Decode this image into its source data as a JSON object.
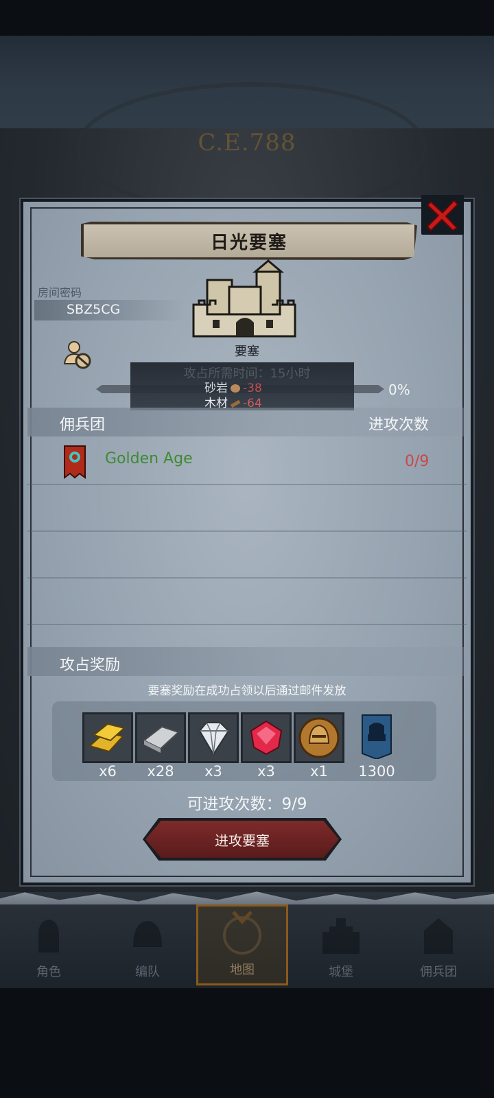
{
  "era": "C.E.788",
  "modal": {
    "title": "日光要塞",
    "room": {
      "label": "房间密码",
      "code": "SBZ5CG"
    },
    "fortress_label": "要塞",
    "cost": {
      "ghost_line": "攻占所需时间：15小时",
      "row1_name": "砂岩",
      "row1_value": "-38",
      "row2_name": "木材",
      "row2_value": "-64"
    },
    "progress": {
      "label": "0%",
      "value": 0
    }
  },
  "guild_section": {
    "title": "佣兵团",
    "count_header": "进攻次数",
    "rows": [
      {
        "name": "Golden Age",
        "count": "0/9"
      }
    ]
  },
  "reward_section": {
    "title": "攻占奖励",
    "note": "要塞奖励在成功占领以后通过邮件发放",
    "items": [
      {
        "icon": "gold-bar-icon",
        "qty": "x6"
      },
      {
        "icon": "iron-bar-icon",
        "qty": "x28"
      },
      {
        "icon": "diamond-icon",
        "qty": "x3"
      },
      {
        "icon": "ruby-icon",
        "qty": "x3"
      },
      {
        "icon": "helmet-medal-icon",
        "qty": "x1"
      },
      {
        "icon": "fortress-flag-icon",
        "qty": "1300"
      }
    ]
  },
  "attack_count": "可进攻次数：9/9",
  "attack_button": "进攻要塞",
  "nav": [
    {
      "label": "角色"
    },
    {
      "label": "编队"
    },
    {
      "label": "地图"
    },
    {
      "label": "城堡"
    },
    {
      "label": "佣兵团"
    }
  ],
  "colors": {
    "accent_red": "#c74a4a",
    "guild_green": "#3d8a33",
    "button_red": "#7d2a2a"
  }
}
